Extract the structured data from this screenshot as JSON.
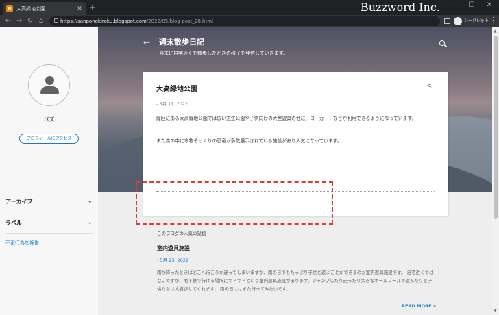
{
  "browser": {
    "tab": {
      "favicon": "B",
      "title": "大高緑地公園",
      "close": "✕"
    },
    "new_tab": "+",
    "brand": "Buzzword Inc.",
    "window_controls": {
      "minimize": "—",
      "maximize": "☐",
      "close": "✕"
    },
    "nav": {
      "back": "←",
      "forward": "→",
      "reload": "↻",
      "home": "⌂"
    },
    "url": {
      "host": "https://sanponokiroku.blogspot.com",
      "path": "/2022/05/blog-post_28.html"
    },
    "bookmark_star": "☆",
    "incognito_label": "シークレット",
    "menu": "⋮"
  },
  "sidebar": {
    "author": "バズ",
    "profile_button": "プロフィールにアクセス",
    "items": [
      {
        "label": "アーカイブ",
        "chevron": "⌄"
      },
      {
        "label": "ラベル",
        "chevron": "⌄"
      }
    ],
    "report_link": "不正行為を報告"
  },
  "header": {
    "back": "←",
    "title": "週末散歩日記",
    "description": "週末に自宅近くを散歩したときの様子を発信していきます。"
  },
  "post": {
    "title": "大高緑地公園",
    "share": "<",
    "date": "- 5月 17, 2022",
    "paragraphs": [
      "緑区にある大高緑地公園では広い芝生公園や子供向けの大型遊具の他に、ゴーカートなどが利用できるようになっています。",
      "また森の中に本物そっくりの恐竜が多数展示されている施設があり人気になっています。"
    ]
  },
  "popular": {
    "heading": "このブログの人気の投稿",
    "title": "室内遊具施設",
    "date": "- 5月 23, 2022",
    "snippet": "雨が降ったときはどこへ行こうか迷ってしまいますが、雨の日でもたっぷり子供と遊ぶことができるのが室内遊具施設です。 自宅近くではないですが、地下鉄で行ける場所にキドキドという室内遊具施設があります。ジャンプしたり走ったり大きなボールプールで遊んだりと子供たちは大喜びしてくれます。 雨の日にはまた行ってみたいです。",
    "read_more": "READ MORE »"
  },
  "colors": {
    "accent": "#1976d2",
    "highlight": "#e53935"
  }
}
